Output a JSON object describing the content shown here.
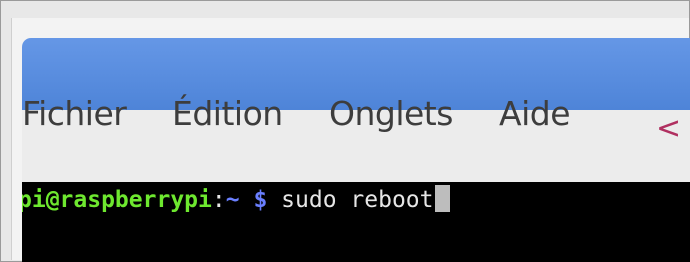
{
  "menubar": {
    "items": [
      {
        "label": "Fichier"
      },
      {
        "label": "Édition"
      },
      {
        "label": "Onglets"
      },
      {
        "label": "Aide"
      }
    ]
  },
  "annotation": {
    "glyph": "<",
    "color": "#b03060"
  },
  "terminal": {
    "user_host": "pi@raspberrypi",
    "separator": ":",
    "path": "~",
    "prompt_symbol": "$",
    "command": "sudo reboot",
    "colors": {
      "user_host": "#6ee82f",
      "path": "#6a7fff",
      "command": "#e6e6e6",
      "background": "#000000"
    }
  },
  "titlebar": {
    "color": "#5b8ee0"
  }
}
